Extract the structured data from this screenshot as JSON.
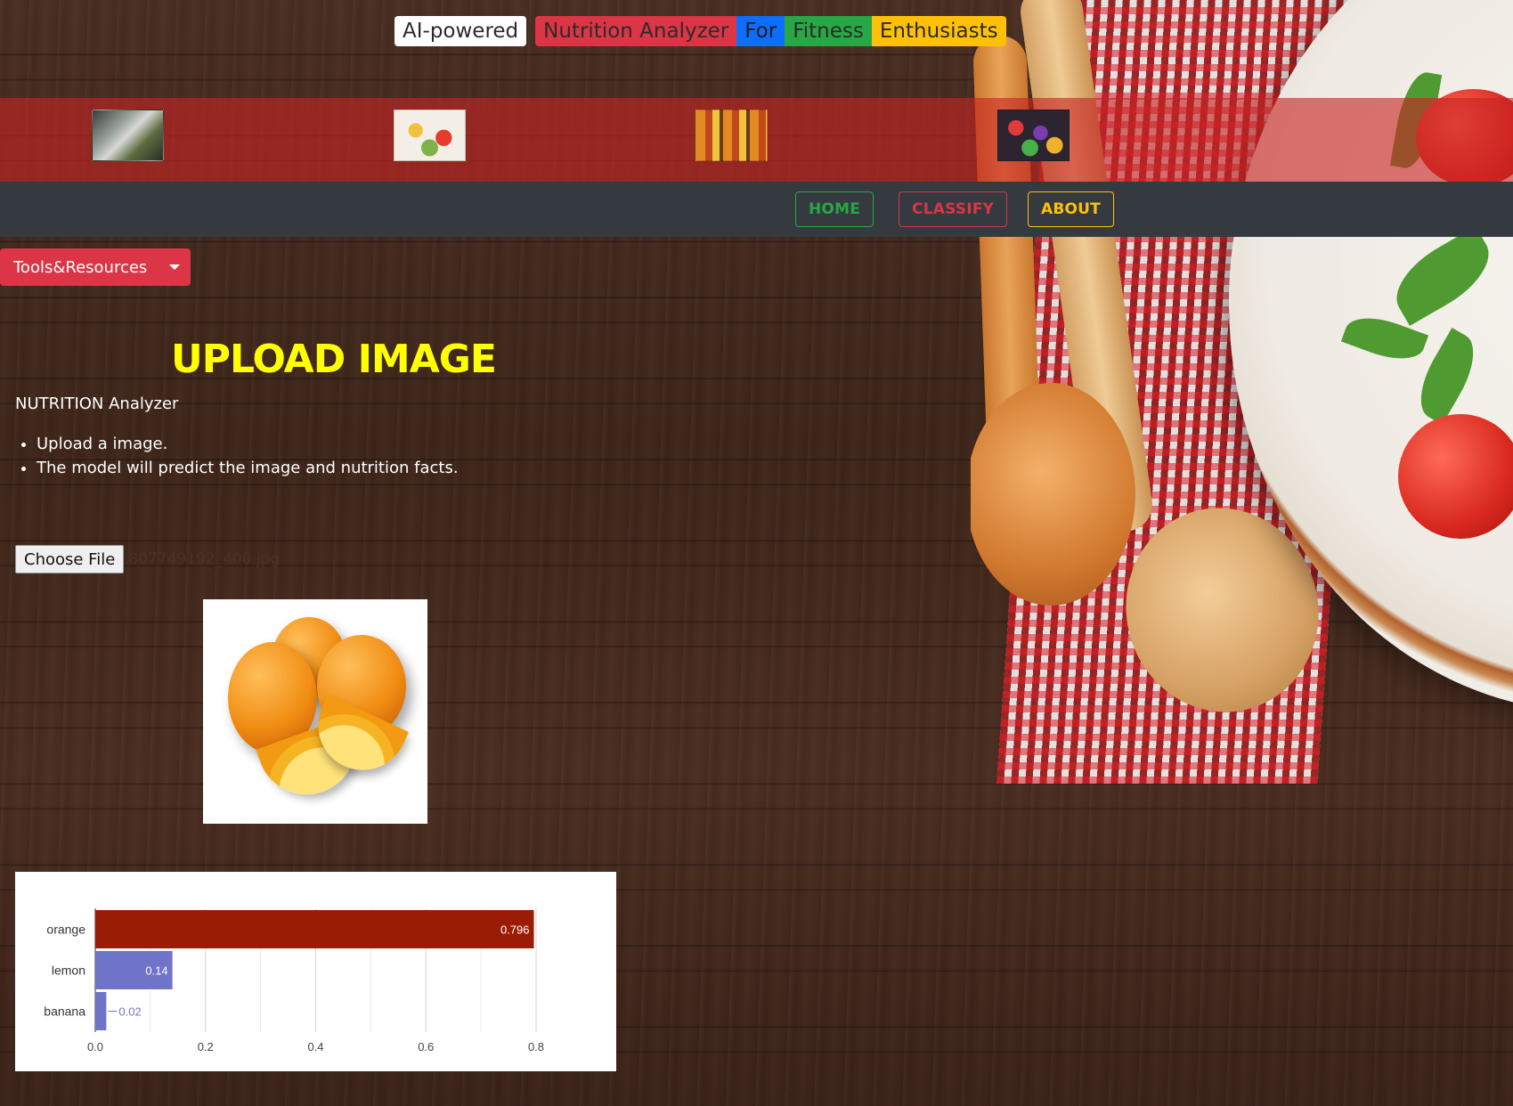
{
  "title_tags": [
    {
      "text": "AI-powered",
      "style": "white"
    },
    {
      "text": "Nutrition Analyzer",
      "style": "red"
    },
    {
      "text": "For",
      "style": "blue"
    },
    {
      "text": "Fitness",
      "style": "green"
    },
    {
      "text": "Enthusiasts",
      "style": "yellow"
    }
  ],
  "thumbnails": [
    "phone-food-photo",
    "fruit-platter",
    "fruit-market-crates",
    "mixed-fruits"
  ],
  "nav": {
    "home": "HOME",
    "classify": "CLASSIFY",
    "about": "ABOUT"
  },
  "dropdown": {
    "label": "Tools&Resources"
  },
  "main": {
    "heading": "UPLOAD IMAGE",
    "subtitle": "NUTRITION Analyzer",
    "steps": [
      "Upload a image.",
      "The model will predict the image and nutrition facts."
    ],
    "choose_file": "Choose File",
    "filename": "807749192_400.jpg"
  },
  "colors": {
    "accent_red": "#dc3545",
    "accent_green": "#28a745",
    "accent_yellow": "#ffc107",
    "accent_blue": "#0d6efd",
    "heading_yellow": "#ffff00",
    "bar_top": "#9b1c05",
    "bar_other": "#6f74c8"
  },
  "chart_data": {
    "type": "bar",
    "orientation": "horizontal",
    "categories": [
      "orange",
      "lemon",
      "banana"
    ],
    "values": [
      0.796,
      0.14,
      0.02
    ],
    "value_labels": [
      "0.796",
      "0.14",
      "0.02"
    ],
    "xlim": [
      0,
      0.8
    ],
    "xticks": [
      "0.0",
      "0.2",
      "0.4",
      "0.6",
      "0.8"
    ],
    "grid": true
  }
}
